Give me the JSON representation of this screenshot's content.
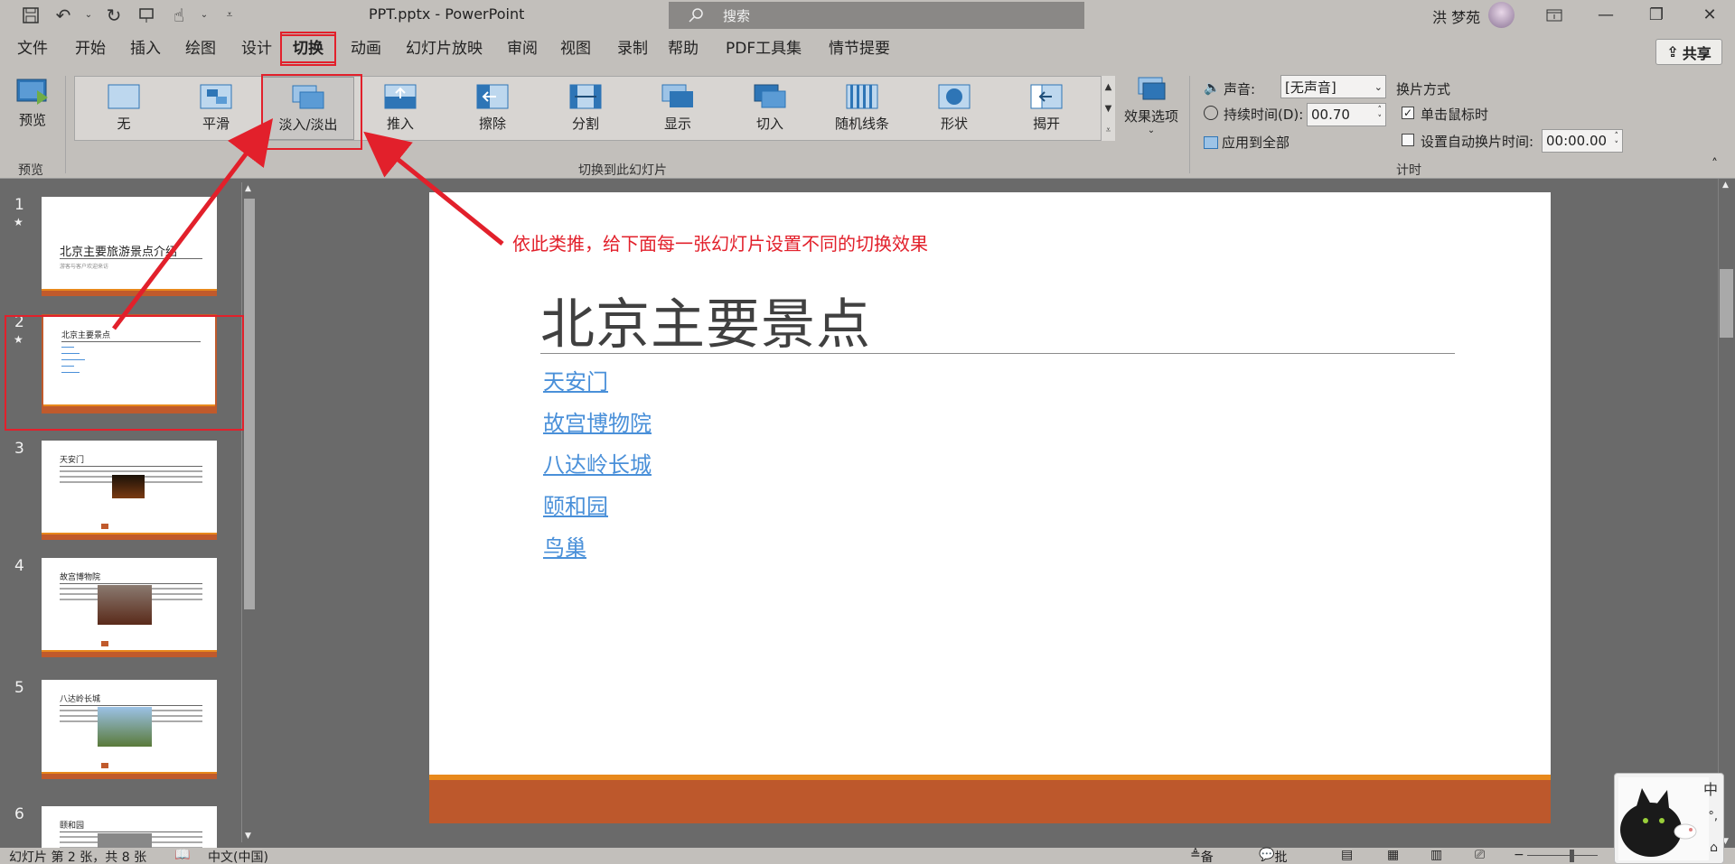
{
  "window": {
    "doc_title": "PPT.pptx  -  PowerPoint",
    "search_placeholder": "搜索",
    "user_name": "洪 梦苑"
  },
  "ribbon_tabs": [
    "文件",
    "开始",
    "插入",
    "绘图",
    "设计",
    "切换",
    "动画",
    "幻灯片放映",
    "审阅",
    "视图",
    "录制",
    "帮助",
    "PDF工具集",
    "情节提要"
  ],
  "active_tab": "切换",
  "share_label": "共享",
  "preview": {
    "button_label": "预览",
    "group_label": "预览"
  },
  "transitions": {
    "items": [
      "无",
      "平滑",
      "淡入/淡出",
      "推入",
      "擦除",
      "分割",
      "显示",
      "切入",
      "随机线条",
      "形状",
      "揭开"
    ],
    "selected": "淡入/淡出",
    "group_label": "切换到此幻灯片",
    "effect_options_label": "效果选项"
  },
  "timing": {
    "sound_label": "声音:",
    "sound_value": "[无声音]",
    "duration_label": "持续时间(D):",
    "duration_value": "00.70",
    "apply_all_label": "应用到全部",
    "advance_header": "换片方式",
    "on_click_label": "单击鼠标时",
    "on_click_checked": true,
    "auto_after_label": "设置自动换片时间:",
    "auto_after_value": "00:00.00",
    "auto_after_checked": false,
    "group_label": "计时"
  },
  "thumbnails": [
    {
      "num": "1",
      "star": true,
      "title": "北京主要旅游景点介绍",
      "subtitle": "游客与客户欢迎来访"
    },
    {
      "num": "2",
      "star": true,
      "title": "北京主要景点"
    },
    {
      "num": "3",
      "star": false,
      "title": "天安门"
    },
    {
      "num": "4",
      "star": false,
      "title": "故宫博物院"
    },
    {
      "num": "5",
      "star": false,
      "title": "八达岭长城"
    },
    {
      "num": "6",
      "star": false,
      "title": "颐和园"
    }
  ],
  "current_slide": {
    "title": "北京主要景点",
    "links": [
      "天安门",
      "故宫博物院",
      "八达岭长城",
      "颐和园",
      "鸟巢"
    ]
  },
  "annotation": "依此类推，给下面每一张幻灯片设置不同的切换效果",
  "status": {
    "slide_info": "幻灯片 第 2 张，共 8 张",
    "language": "中文(中国)",
    "notes_label": "备注",
    "comments_label": "批注"
  },
  "ime": {
    "mode": "中",
    "punct": "°,"
  },
  "colors": {
    "accent_red": "#e2202b",
    "theme_orange": "#bd582c",
    "link_blue": "#4a90d9"
  }
}
